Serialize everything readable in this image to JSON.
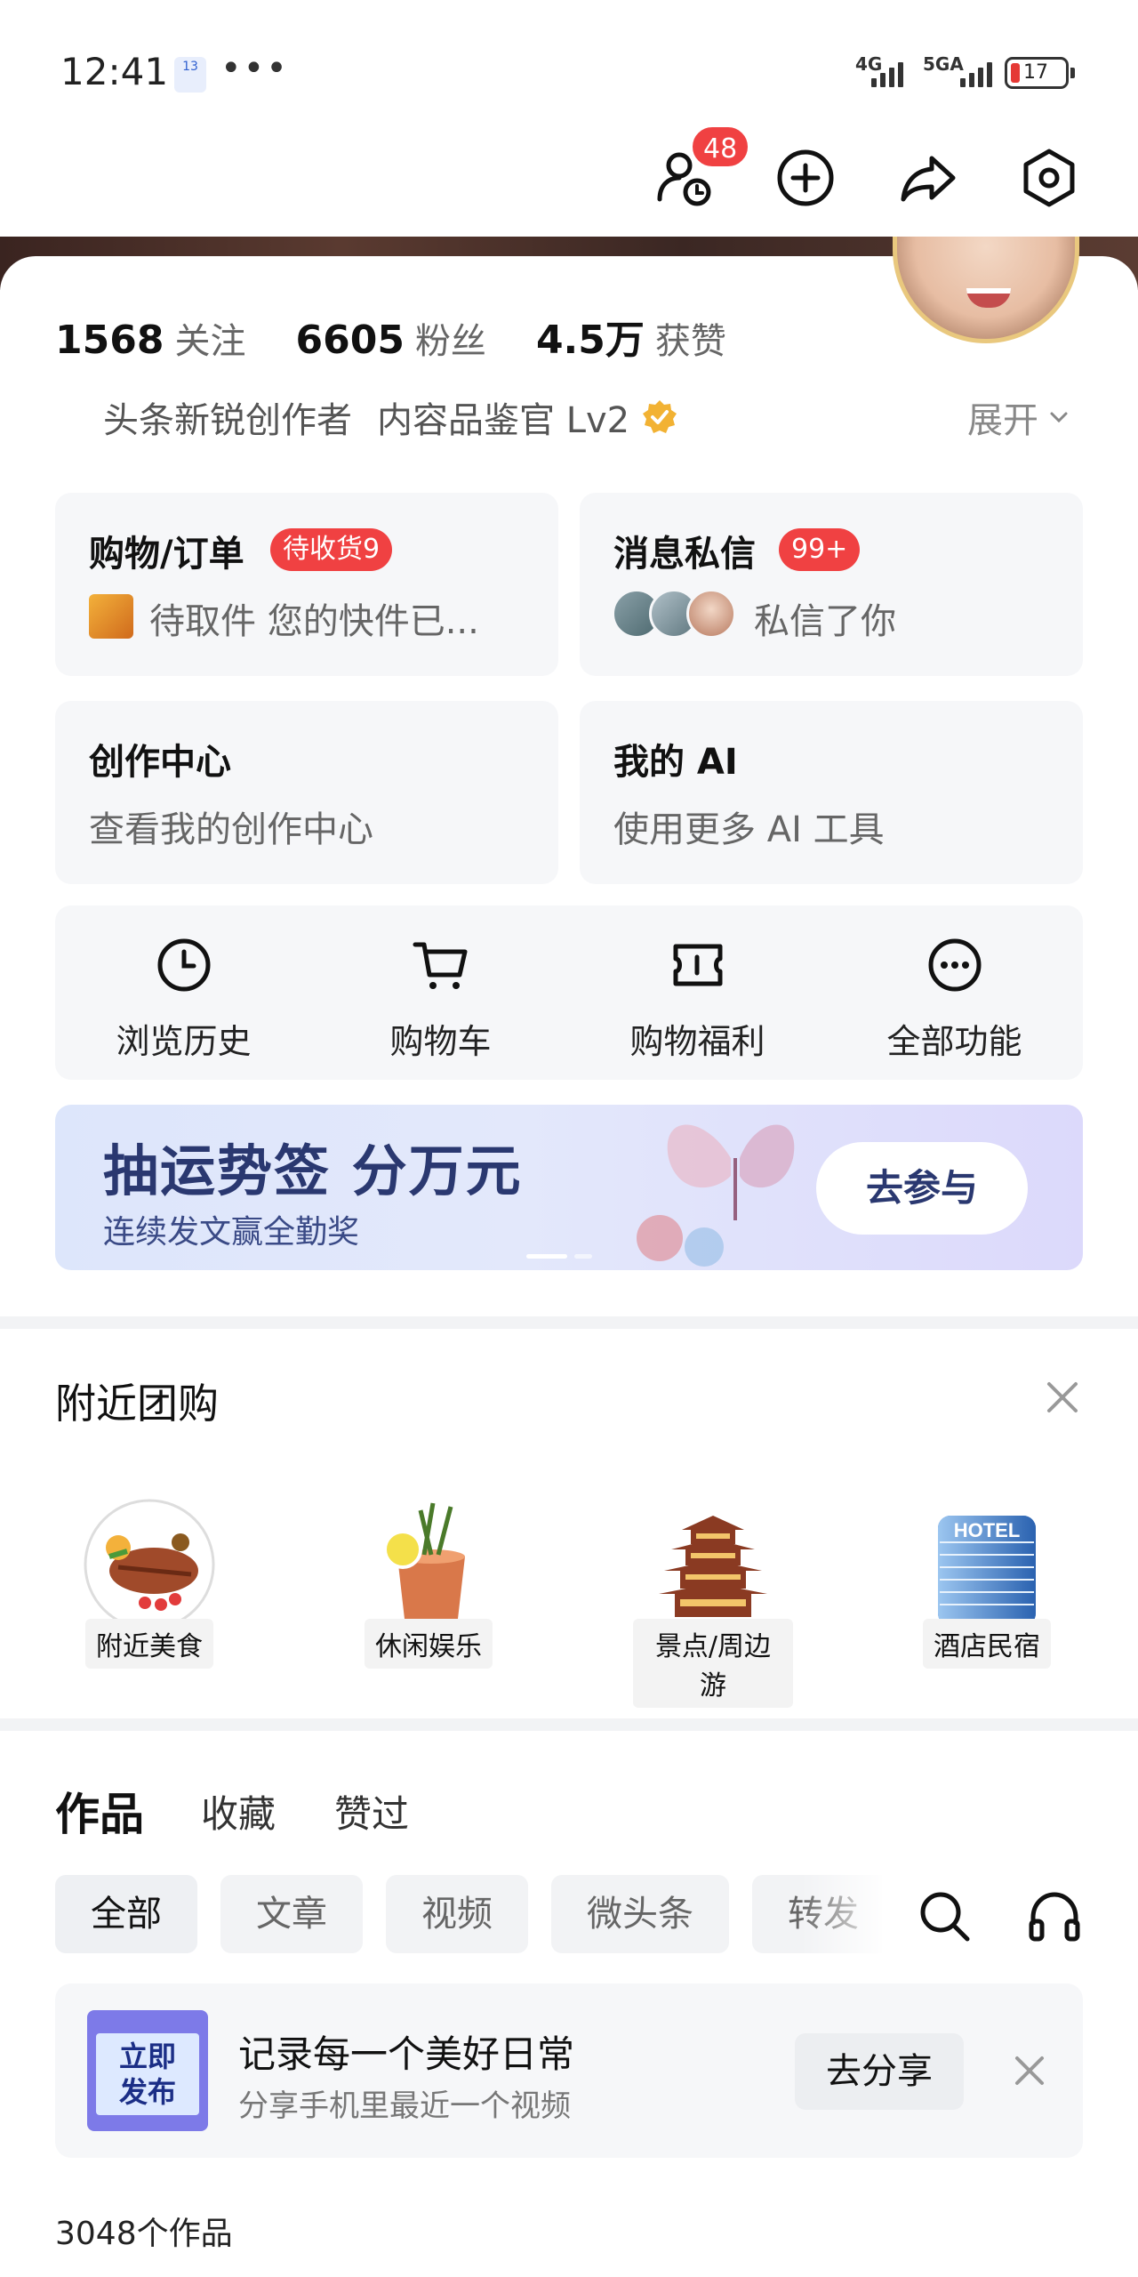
{
  "status_bar": {
    "time": "12:41",
    "date_badge": "13",
    "more": "•••",
    "net1": "4G",
    "net2": "5GA",
    "battery": "17"
  },
  "top_bar": {
    "visitor_badge": "48",
    "icons": [
      "visitor-clock-icon",
      "add-circle-icon",
      "share-icon",
      "settings-hex-icon"
    ]
  },
  "profile": {
    "stats": [
      {
        "num": "1568",
        "label": "关注"
      },
      {
        "num": "6605",
        "label": "粉丝"
      },
      {
        "num": "4.5万",
        "label": "获赞"
      }
    ],
    "title1": "头条新锐创作者",
    "title2": "内容品鉴官 Lv2",
    "expand": "展开"
  },
  "cards": {
    "orders": {
      "title": "购物/订单",
      "badge": "待收货9",
      "sub": "待取件 您的快件已..."
    },
    "messages": {
      "title": "消息私信",
      "badge": "99+",
      "sub": "私信了你"
    },
    "creator": {
      "title": "创作中心",
      "sub": "查看我的创作中心"
    },
    "ai": {
      "title": "我的 AI",
      "sub": "使用更多 AI 工具"
    }
  },
  "tools": [
    {
      "label": "浏览历史",
      "icon": "clock-icon"
    },
    {
      "label": "购物车",
      "icon": "cart-icon"
    },
    {
      "label": "购物福利",
      "icon": "ticket-icon"
    },
    {
      "label": "全部功能",
      "icon": "more-circle-icon"
    }
  ],
  "banner": {
    "title": "抽运势签 分万元",
    "subtitle": "连续发文赢全勤奖",
    "button": "去参与"
  },
  "nearby": {
    "heading": "附近团购",
    "items": [
      {
        "label": "附近美食"
      },
      {
        "label": "休闲娱乐"
      },
      {
        "label": "景点/周边游"
      },
      {
        "label": "酒店民宿"
      }
    ],
    "hotel_sign": "HOTEL"
  },
  "works": {
    "tabs": [
      "作品",
      "收藏",
      "赞过"
    ],
    "filters": [
      "全部",
      "文章",
      "视频",
      "微头条",
      "转发"
    ],
    "promo": {
      "image_text_1": "立即",
      "image_text_2": "发布",
      "title": "记录每一个美好日常",
      "subtitle": "分享手机里最近一个视频",
      "button": "去分享"
    },
    "count": "3048个作品"
  },
  "colors": {
    "badge_red": "#f04142",
    "banner_text": "#2a3870",
    "verified_gold": "#f2b233"
  }
}
